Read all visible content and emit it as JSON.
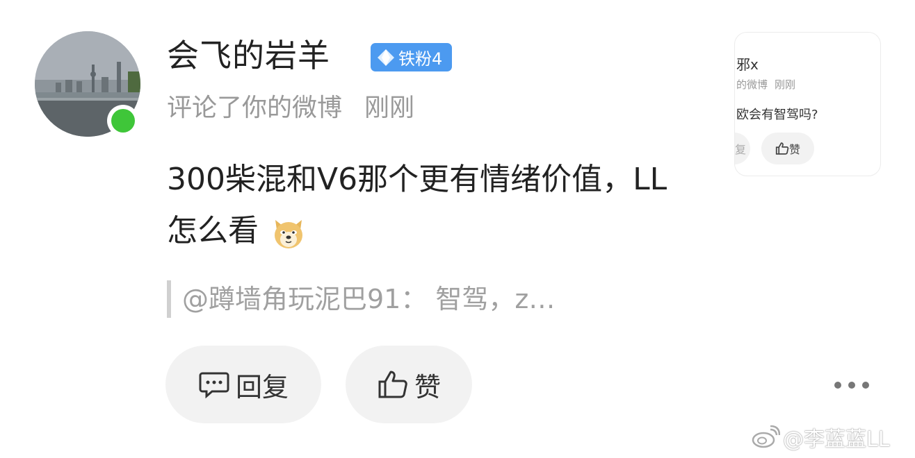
{
  "notification": {
    "user": {
      "name": "会飞的岩羊",
      "badge": "铁粉4",
      "online": true
    },
    "action": "评论了你的微博",
    "time": "刚刚",
    "content_text": "300柴混和V6那个更有情绪价值，LL怎么看",
    "emoji": "doge-emoji",
    "quote": "@蹲墙角玩泥巴91：  智驾，z…",
    "buttons": {
      "reply": "回复",
      "like": "赞"
    }
  },
  "preview_card": {
    "name": "邪x",
    "meta_action": "的微博",
    "meta_time": "刚刚",
    "text": "欧会有智驾吗?",
    "cut_button": "复",
    "like": "赞"
  },
  "watermark": "@李蓝蓝LL",
  "colors": {
    "badge": "#4c9af0",
    "online": "#3fc639",
    "button_bg": "#f2f2f2",
    "meta_text": "#999999"
  }
}
